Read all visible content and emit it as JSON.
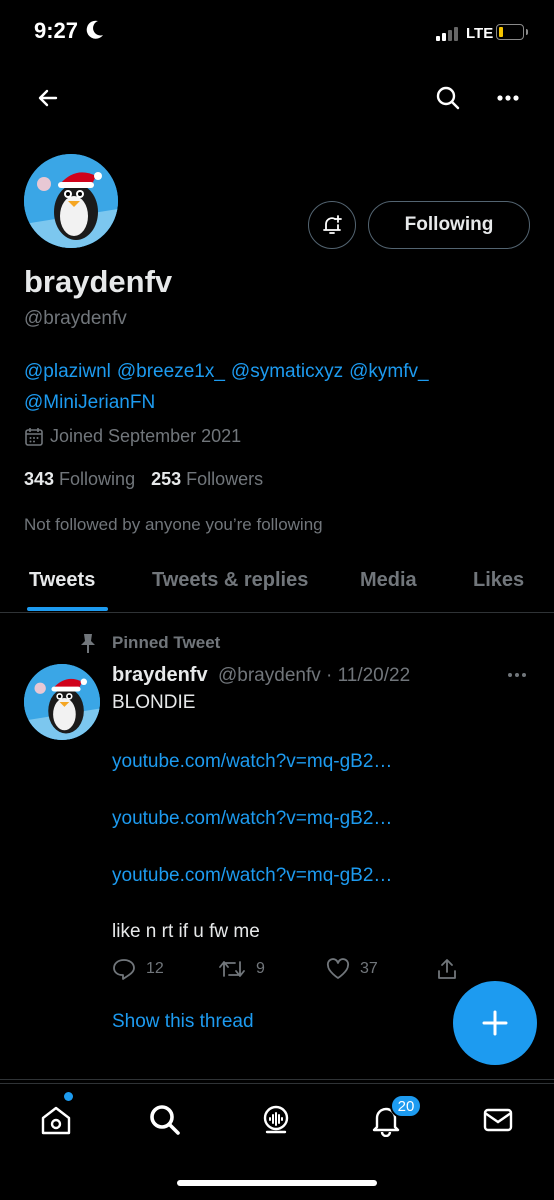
{
  "status_bar": {
    "time": "9:27",
    "network": "LTE"
  },
  "profile": {
    "display_name": "braydenfv",
    "handle": "@braydenfv",
    "follow_button": "Following",
    "bio_mentions": [
      "@plaziwnl",
      "@breeze1x_",
      "@symaticxyz",
      "@kymfv_",
      "@MiniJerianFN"
    ],
    "joined": "Joined September 2021",
    "following_count": "343",
    "following_label": "Following",
    "followers_count": "253",
    "followers_label": "Followers",
    "not_followed_text": "Not followed by anyone you’re following"
  },
  "tabs": [
    {
      "label": "Tweets",
      "active": true
    },
    {
      "label": "Tweets & replies",
      "active": false
    },
    {
      "label": "Media",
      "active": false
    },
    {
      "label": "Likes",
      "active": false
    }
  ],
  "pinned_tweet": {
    "pinned_label": "Pinned Tweet",
    "author_name": "braydenfv",
    "meta": "@braydenfv · 11/20/22",
    "line1": "BLONDIE",
    "links": [
      "youtube.com/watch?v=mq-gB2…",
      "youtube.com/watch?v=mq-gB2…",
      "youtube.com/watch?v=mq-gB2…"
    ],
    "line2": "like n rt if u fw me",
    "replies": "12",
    "retweets": "9",
    "likes": "37",
    "show_thread": "Show this thread"
  },
  "bottom_nav": {
    "notifications_badge": "20"
  },
  "icons": [
    "back-arrow-icon",
    "search-icon",
    "more-icon",
    "bell-plus-icon",
    "calendar-icon",
    "pin-icon",
    "reply-icon",
    "retweet-icon",
    "like-icon",
    "share-icon",
    "plus-icon",
    "home-icon",
    "spaces-icon",
    "bell-icon",
    "mail-icon"
  ],
  "colors": {
    "accent": "#1d9bf0",
    "background": "#000000",
    "secondary_text": "#71767b",
    "divider": "#2f3336"
  }
}
